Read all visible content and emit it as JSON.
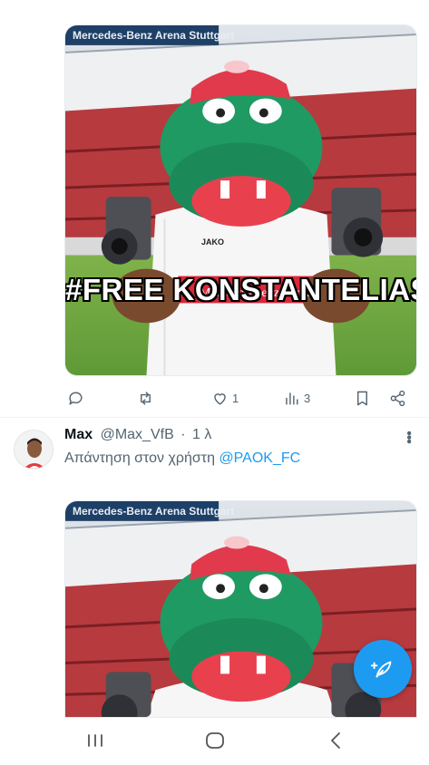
{
  "tweet_1": {
    "image": {
      "overlay_text": "#FREE KONSTANTELIAS",
      "stadium_sign": "Mercedes-Benz Arena Stuttgart",
      "shirt_sponsor": "Mercedes-Benz Bank",
      "shirt_brand": "JAKO"
    },
    "actions": {
      "reply_icon": "reply-icon",
      "retweet_icon": "retweet-icon",
      "like_icon": "heart-icon",
      "like_count": "1",
      "views_icon": "views-icon",
      "views_count": "3",
      "bookmark_icon": "bookmark-icon",
      "share_icon": "share-icon"
    }
  },
  "tweet_2": {
    "author_name": "Max",
    "author_handle": "@Max_VfB",
    "separator": "·",
    "time": "1 λ",
    "reply_prefix": "Απάντηση στον χρήστη",
    "reply_mention": "@PAOK_FC",
    "image": {
      "stadium_sign": "Mercedes-Benz Arena Stuttgart"
    }
  },
  "fab": {
    "icon": "compose-feather-icon"
  },
  "navbar": {
    "recents_icon": "recents-icon",
    "home_icon": "home-icon",
    "back_icon": "back-icon"
  },
  "colors": {
    "accent": "#1d9bf0",
    "secondary_text": "#536471",
    "mascot_green": "#1f9a63",
    "cap_red": "#e03a4c"
  }
}
